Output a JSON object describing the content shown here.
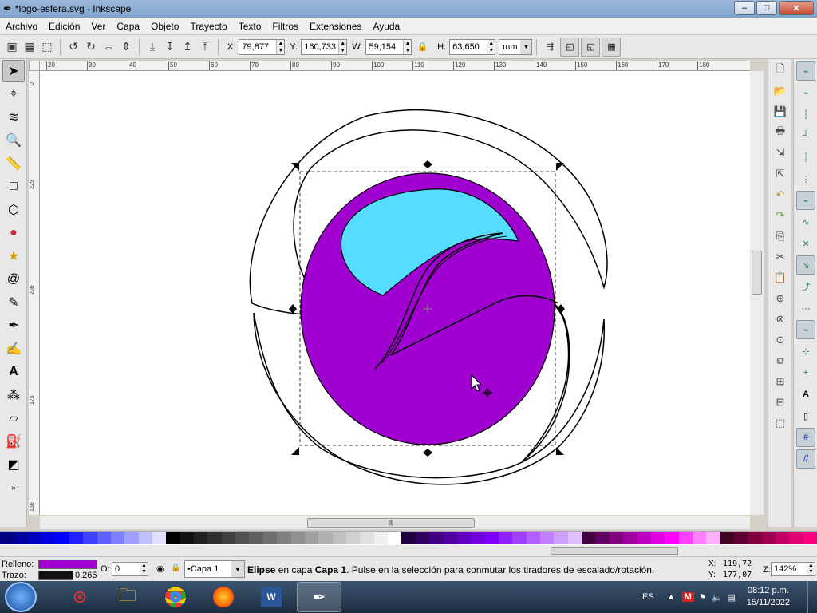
{
  "window": {
    "title": "*logo-esfera.svg - Inkscape",
    "minimize": "–",
    "maximize": "□",
    "close": "✕"
  },
  "menubar": {
    "items": [
      "Archivo",
      "Edición",
      "Ver",
      "Capa",
      "Objeto",
      "Trayecto",
      "Texto",
      "Filtros",
      "Extensiones",
      "Ayuda"
    ]
  },
  "toolcontrols": {
    "x_label": "X:",
    "x_value": "79,877",
    "y_label": "Y:",
    "y_value": "160,733",
    "w_label": "W:",
    "w_value": "59,154",
    "h_label": "H:",
    "h_value": "63,650",
    "unit": "mm"
  },
  "ruler_top": [
    "20",
    "30",
    "40",
    "50",
    "60",
    "70",
    "80",
    "90",
    "100",
    "110",
    "120",
    "130",
    "140",
    "150",
    "160",
    "170",
    "180"
  ],
  "ruler_left": [
    "0",
    "225",
    "200",
    "175",
    "150"
  ],
  "canvas": {
    "fill_color": "#a000d0",
    "highlight_color": "#55dcff",
    "stroke_color": "#000000"
  },
  "palette": [
    "#000080",
    "#0000a0",
    "#0000c0",
    "#0000e0",
    "#0000ff",
    "#2020ff",
    "#4040ff",
    "#6060ff",
    "#8080ff",
    "#a0a0ff",
    "#c0c0ff",
    "#e0e0ff",
    "#000000",
    "#101010",
    "#202020",
    "#303030",
    "#404040",
    "#505050",
    "#606060",
    "#707070",
    "#808080",
    "#909090",
    "#a0a0a0",
    "#b0b0b0",
    "#c0c0c0",
    "#d0d0d0",
    "#e0e0e0",
    "#f0f0f0",
    "#ffffff",
    "#200040",
    "#300060",
    "#400080",
    "#5000a0",
    "#6000c0",
    "#7000e0",
    "#8000ff",
    "#9020ff",
    "#a040ff",
    "#b060ff",
    "#c080ff",
    "#d0a0ff",
    "#e0c0ff",
    "#400040",
    "#600060",
    "#800080",
    "#a000a0",
    "#c000c0",
    "#e000e0",
    "#ff00ff",
    "#ff40ff",
    "#ff80ff",
    "#ffb0ff",
    "#400020",
    "#600030",
    "#800040",
    "#a00050",
    "#c00060",
    "#e00070",
    "#ff0080"
  ],
  "status": {
    "fill_label": "Relleno:",
    "stroke_label": "Trazo:",
    "fill_color": "#a000d0",
    "stroke_color": "#000000",
    "stroke_width": "0,265",
    "opacity_label": "O:",
    "opacity_value": "0",
    "layer": "•Capa 1",
    "message_obj": "Elipse",
    "message_mid": " en capa ",
    "message_layer": "Capa 1",
    "message_end": ". Pulse en la selección para conmutar los tiradores de escalado/rotación.",
    "cursor_x_label": "X:",
    "cursor_x": "119,72",
    "cursor_y_label": "Y:",
    "cursor_y": "177,07",
    "zoom_label": "Z:",
    "zoom": "142%"
  },
  "taskbar": {
    "language": "ES",
    "time": "08:12 p.m.",
    "date": "15/11/2022"
  }
}
